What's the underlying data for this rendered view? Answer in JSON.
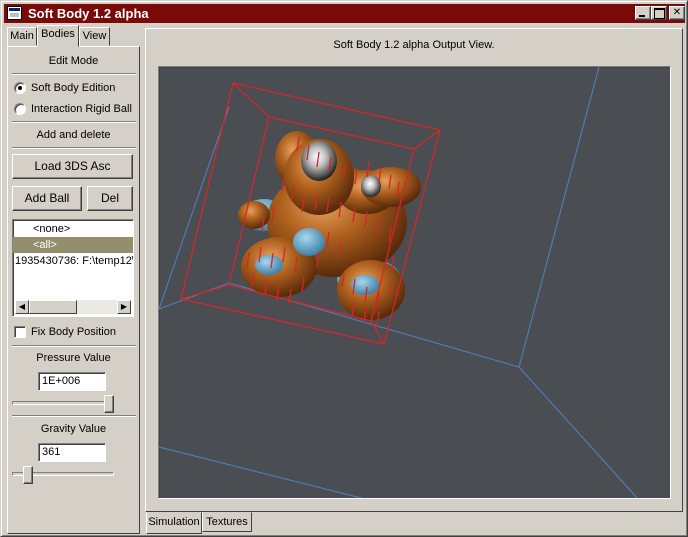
{
  "window": {
    "title": "Soft Body 1.2 alpha",
    "icons": {
      "app": "window-app-icon",
      "minimize": "minimize-icon",
      "maximize": "maximize-icon",
      "close": "close-icon"
    },
    "title_color": "#7a0a0a"
  },
  "left_tabs": [
    {
      "label": "Main",
      "active": false
    },
    {
      "label": "Bodies",
      "active": true
    },
    {
      "label": "View",
      "active": false
    }
  ],
  "panel": {
    "edit_mode_label": "Edit Mode",
    "radio_soft_body": {
      "label": "Soft Body Edition",
      "checked": true
    },
    "radio_rigid_ball": {
      "label": "Interaction Rigid Ball",
      "checked": false
    },
    "add_delete_label": "Add and delete",
    "load_button": "Load 3DS Asc",
    "add_ball_button": "Add Ball",
    "del_button": "Del",
    "list_items": [
      {
        "label": "<none>",
        "selected": false
      },
      {
        "label": "<all>",
        "selected": true
      },
      {
        "label": "1935430736: F:\\temp12\\",
        "selected": false
      }
    ],
    "list_selected_color": "#938e6b",
    "fix_body_label": "Fix Body Position",
    "fix_body_checked": false,
    "pressure_label": "Pressure Value",
    "pressure_value": "1E+006",
    "pressure_slider_fraction": 1.0,
    "gravity_label": "Gravity Value",
    "gravity_value": "361",
    "gravity_slider_fraction": 0.12
  },
  "output": {
    "title": "Soft Body 1.2 alpha Output View.",
    "background_color": "#4a4d52",
    "wire_color": "#d4262a",
    "grid_color": "#4f7bb0"
  },
  "bottom_tabs": [
    {
      "label": "Simulation",
      "active": true
    },
    {
      "label": "Textures",
      "active": false
    }
  ]
}
